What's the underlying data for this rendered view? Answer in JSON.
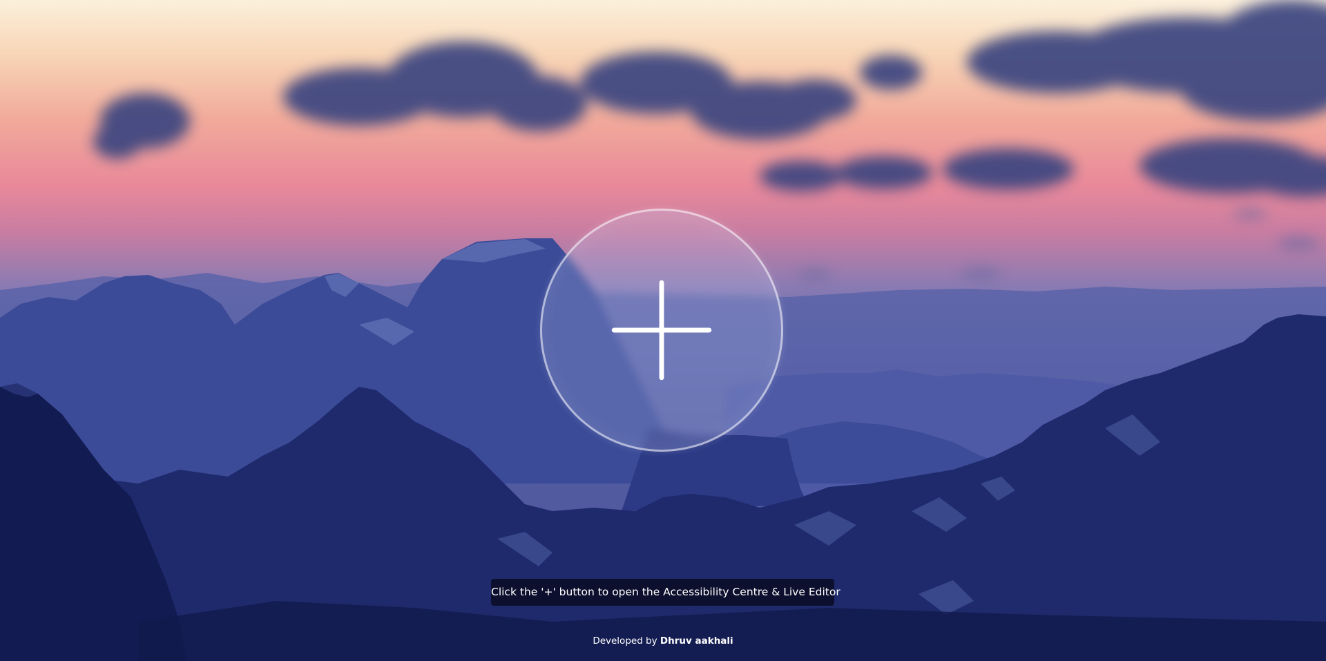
{
  "hint": {
    "text": "Click the '+' button to open the Accessibility Centre & Live Editor"
  },
  "credit": {
    "prefix": "Developed by ",
    "author": "Dhruv aakhali"
  },
  "plus_button": {
    "icon": "plus-icon"
  },
  "background": {
    "description_icon": "mountain-sunset-wallpaper"
  },
  "colors": {
    "hint_background": "#0a0c26",
    "text": "#ffffff"
  }
}
